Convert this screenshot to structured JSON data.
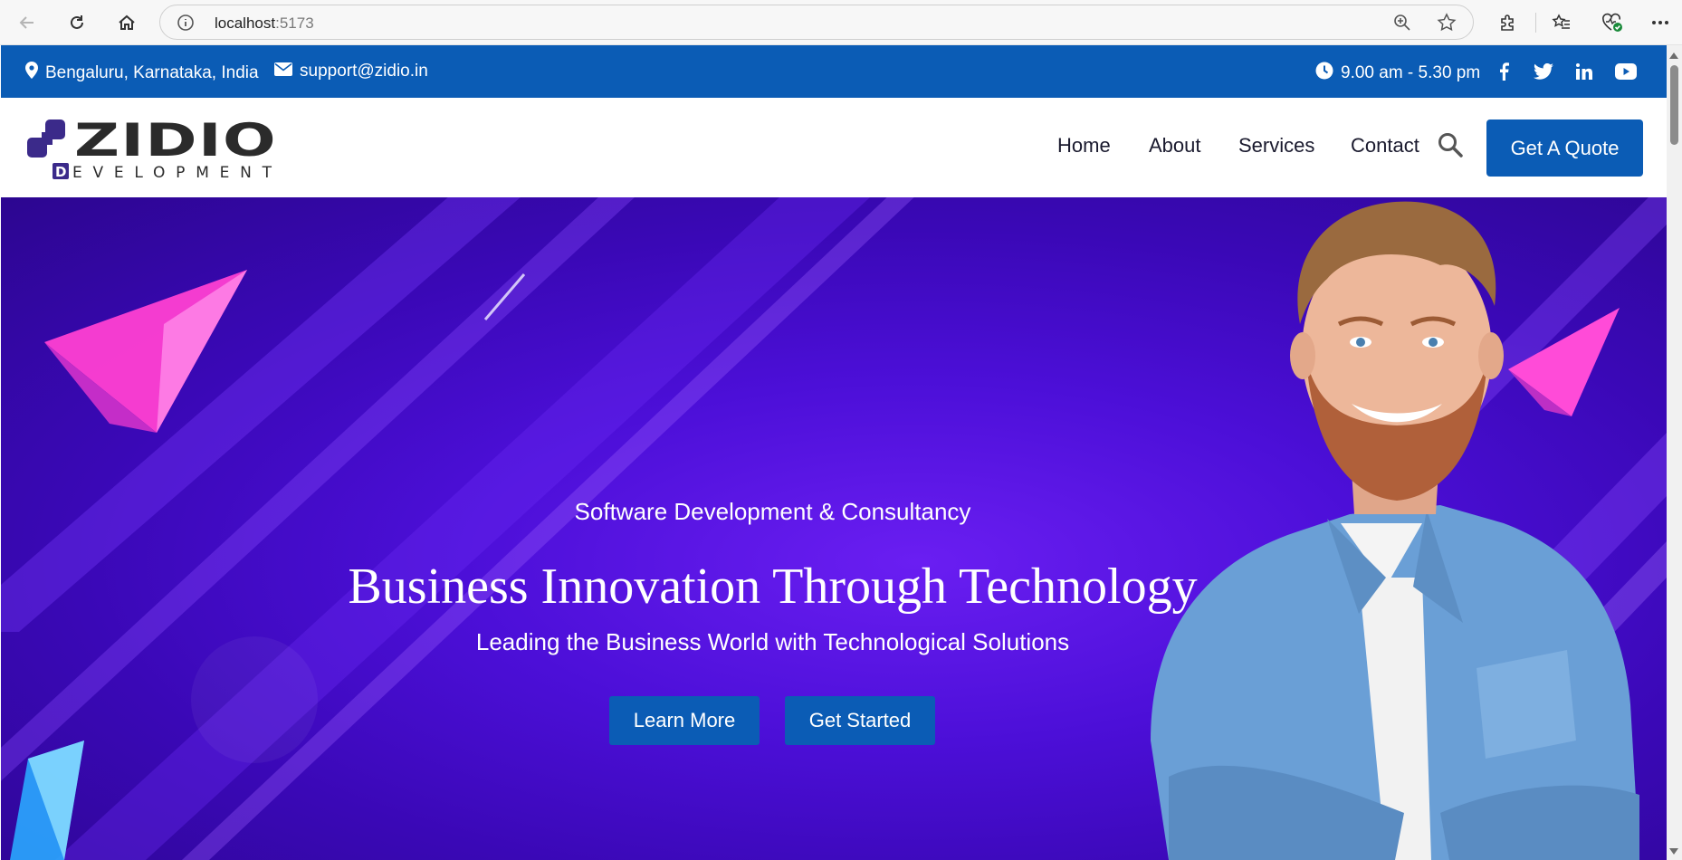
{
  "browser": {
    "url_host": "localhost",
    "url_port": ":5173"
  },
  "topbar": {
    "location": "Bengaluru, Karnataka, India",
    "email": "support@zidio.in",
    "hours": "9.00 am - 5.30 pm",
    "social": [
      "facebook",
      "twitter",
      "linkedin",
      "youtube"
    ]
  },
  "nav": {
    "logo_main": "ZIDIO",
    "logo_sub": "EVELOPMENT",
    "logo_d": "D",
    "links": [
      "Home",
      "About",
      "Services",
      "Contact"
    ],
    "quote_label": "Get A Quote"
  },
  "hero": {
    "subtitle": "Software Development & Consultancy",
    "title": "Business Innovation Through Technology",
    "tagline": "Leading the Business World with Technological Solutions",
    "learn_more": "Learn More",
    "get_started": "Get Started"
  },
  "colors": {
    "primary": "#0b5cb5",
    "hero_purple": "#4c0fd8"
  }
}
